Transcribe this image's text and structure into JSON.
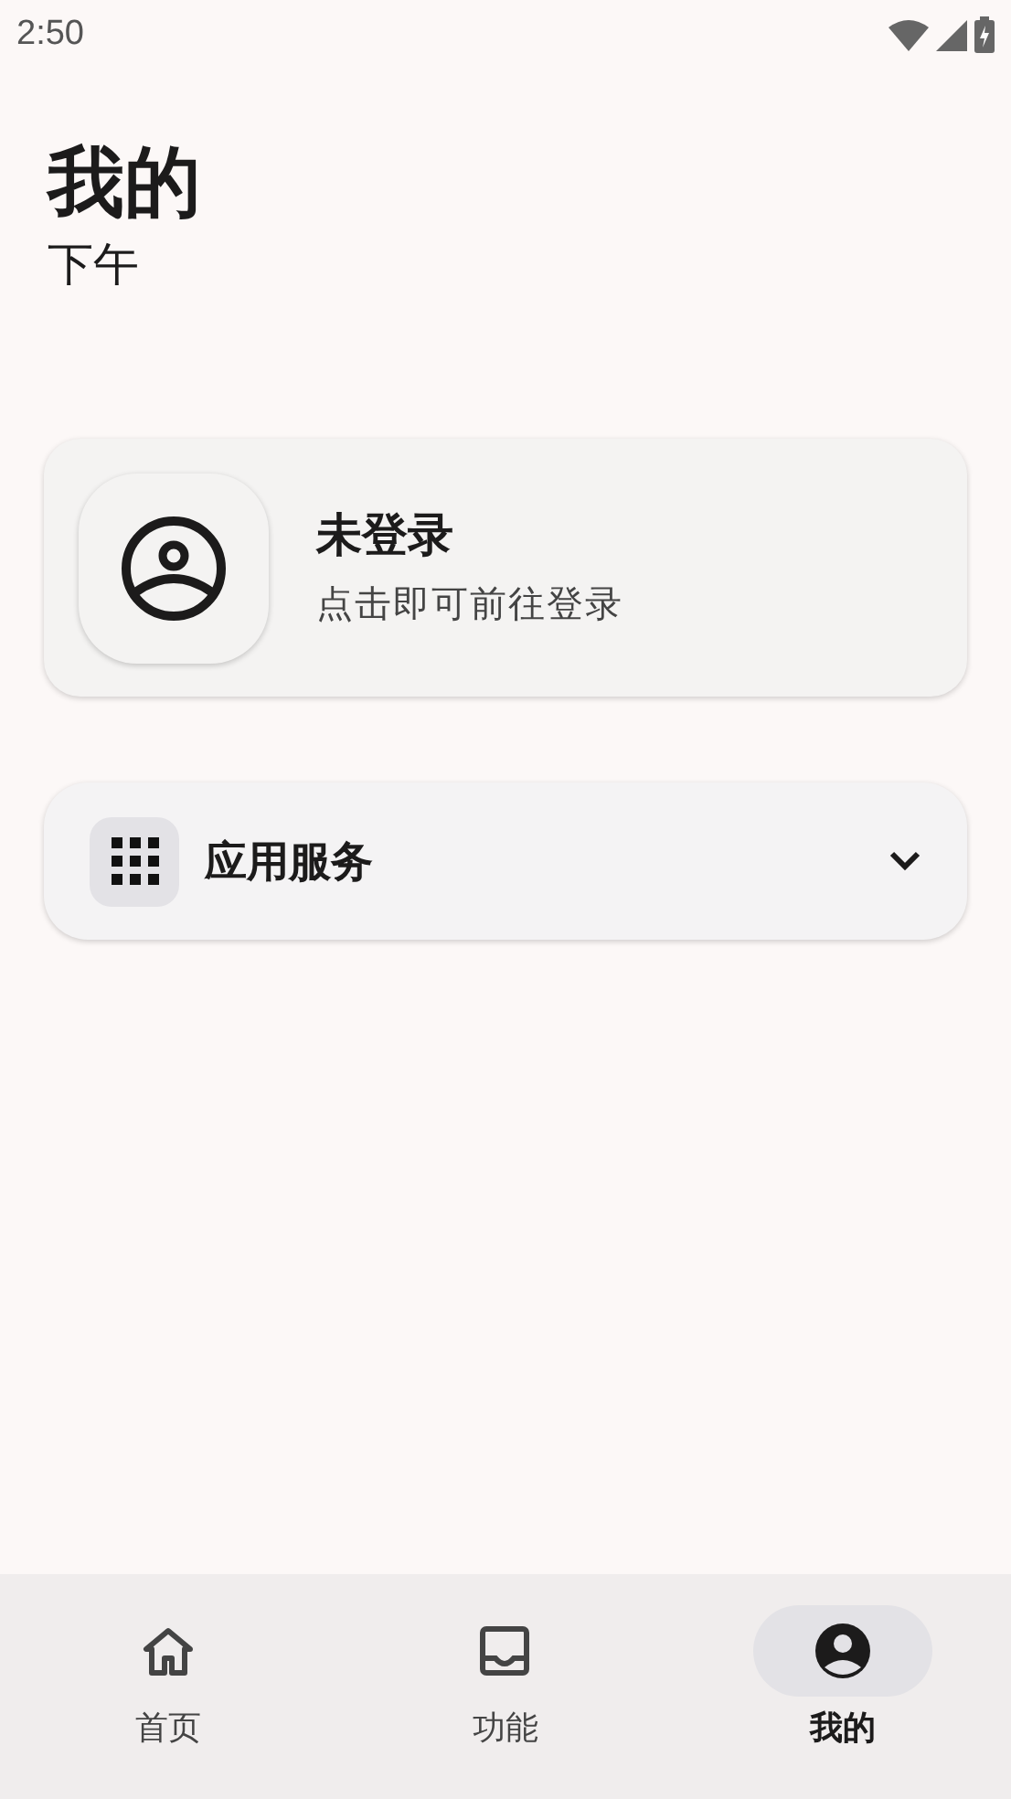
{
  "status_bar": {
    "time": "2:50"
  },
  "header": {
    "title": "我的",
    "subtitle": "下午"
  },
  "account_card": {
    "title": "未登录",
    "subtitle": "点击即可前往登录"
  },
  "services": {
    "label": "应用服务",
    "expanded": false
  },
  "nav": [
    {
      "label": "首页",
      "selected": false
    },
    {
      "label": "功能",
      "selected": false
    },
    {
      "label": "我的",
      "selected": true
    }
  ]
}
